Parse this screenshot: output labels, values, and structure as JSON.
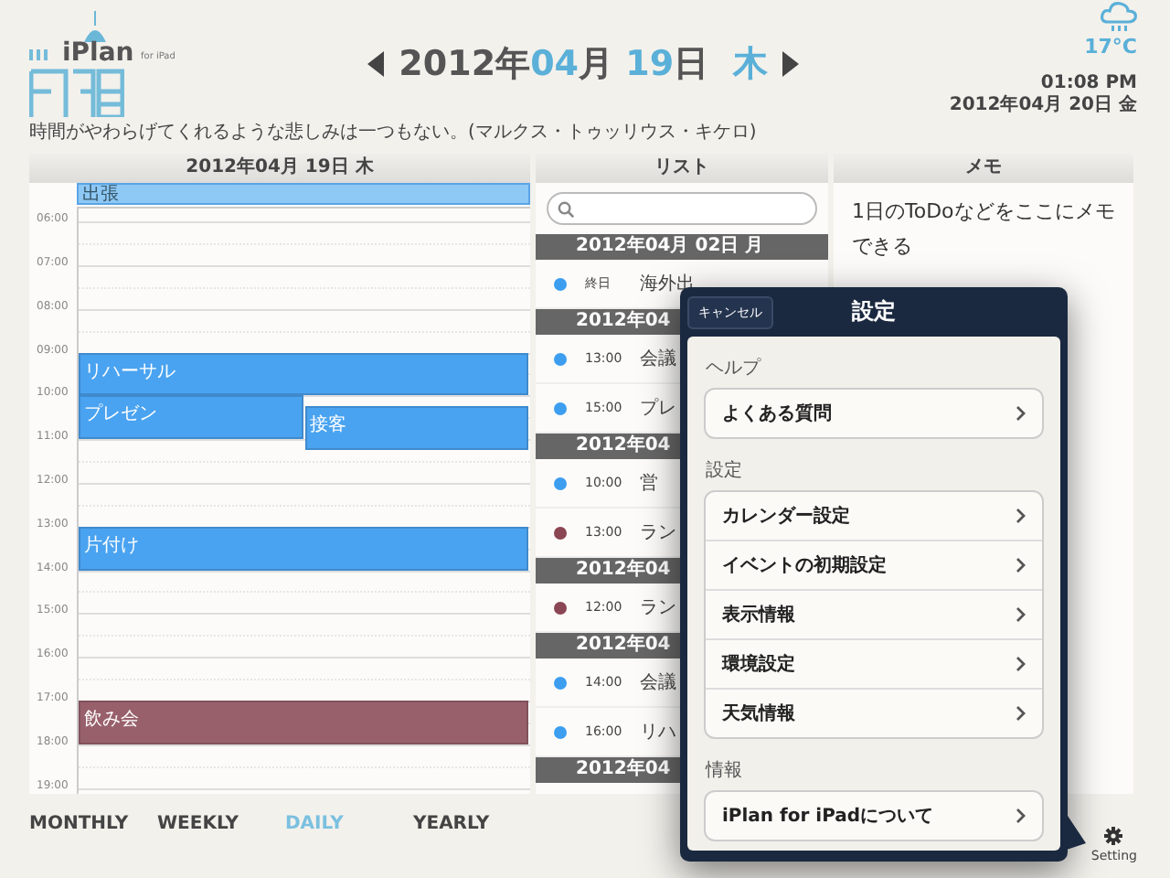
{
  "logo": {
    "name": "iPlan",
    "sub": "for iPad"
  },
  "date": {
    "year": "2012年",
    "month": "04",
    "month_unit": "月",
    "day": "19",
    "day_unit": "日",
    "weekday": "木"
  },
  "quote": "時間がやわらげてくれるような悲しみは一つもない。(マルクス・トゥッリウス・キケロ)",
  "weather": {
    "temperature": "17°C",
    "time": "01:08 PM",
    "date": "2012年04月 20日 金"
  },
  "day_view": {
    "header": "2012年04月 19日  木",
    "hours": [
      "06:00",
      "07:00",
      "08:00",
      "09:00",
      "10:00",
      "11:00",
      "12:00",
      "13:00",
      "14:00",
      "15:00",
      "16:00",
      "17:00",
      "18:00",
      "19:00"
    ],
    "all_day": [
      {
        "title": "出張",
        "color": "#8ec8f5"
      }
    ],
    "events": [
      {
        "title": "リハーサル",
        "color": "#4aa3f0"
      },
      {
        "title": "プレゼン",
        "color": "#4aa3f0"
      },
      {
        "title": "接客",
        "color": "#4aa3f0"
      },
      {
        "title": "片付け",
        "color": "#4aa3f0"
      },
      {
        "title": "飲み会",
        "color": "#98606b"
      }
    ]
  },
  "list": {
    "header": "リスト",
    "groups": [
      {
        "date": "2012年04月 02日  月",
        "items": [
          {
            "time": "終日",
            "title": "海外出",
            "color": "#3d9ef0"
          }
        ]
      },
      {
        "date": "2012年04",
        "items": [
          {
            "time": "13:00",
            "title": "会議",
            "color": "#3d9ef0"
          },
          {
            "time": "15:00",
            "title": "プレ",
            "color": "#3d9ef0"
          }
        ]
      },
      {
        "date": "2012年04",
        "items": [
          {
            "time": "10:00",
            "title": "営",
            "color": "#3d9ef0"
          },
          {
            "time": "13:00",
            "title": "ラン",
            "color": "#8a4653"
          }
        ]
      },
      {
        "date": "2012年04",
        "items": [
          {
            "time": "12:00",
            "title": "ラン",
            "color": "#8a4653"
          }
        ]
      },
      {
        "date": "2012年04",
        "items": [
          {
            "time": "14:00",
            "title": "会議",
            "color": "#3d9ef0"
          },
          {
            "time": "16:00",
            "title": "リハ",
            "color": "#3d9ef0"
          }
        ]
      },
      {
        "date": "2012年04"
      }
    ]
  },
  "memo": {
    "header": "メモ",
    "text": "1日のToDoなどをここにメモできる"
  },
  "view_tabs": [
    {
      "label": "MONTHLY",
      "selected": false
    },
    {
      "label": "WEEKLY",
      "selected": false
    },
    {
      "label": "DAILY",
      "selected": true
    },
    {
      "label": "YEARLY",
      "selected": false
    }
  ],
  "setting_button": "Setting",
  "settings_popover": {
    "title": "設定",
    "cancel": "キャンセル",
    "sections": [
      {
        "title": "ヘルプ",
        "items": [
          "よくある質問"
        ]
      },
      {
        "title": "設定",
        "items": [
          "カレンダー設定",
          "イベントの初期設定",
          "表示情報",
          "環境設定",
          "天気情報"
        ]
      },
      {
        "title": "情報",
        "items": [
          "iPlan for iPadについて"
        ]
      }
    ]
  }
}
